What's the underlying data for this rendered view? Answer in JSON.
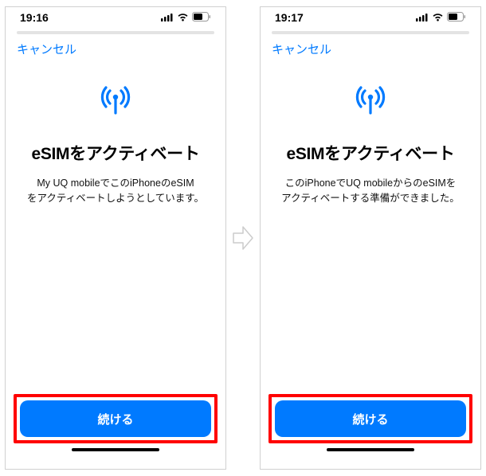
{
  "screens": [
    {
      "time": "19:16",
      "cancel": "キャンセル",
      "title": "eSIMをアクティベート",
      "description_line1": "My UQ mobileでこのiPhoneのeSIM",
      "description_line2": "をアクティベートしようとしています。",
      "button": "続ける"
    },
    {
      "time": "19:17",
      "cancel": "キャンセル",
      "title": "eSIMをアクティベート",
      "description_line1": "このiPhoneでUQ mobileからのeSIMを",
      "description_line2": "アクティベートする準備ができました。",
      "button": "続ける"
    }
  ]
}
